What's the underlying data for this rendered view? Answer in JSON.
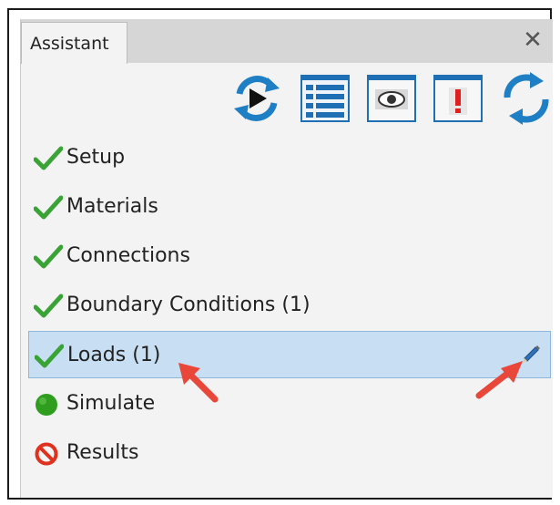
{
  "panel": {
    "tab_label": "Assistant",
    "close_symbol": "✕"
  },
  "toolbar": {
    "buttons": [
      {
        "icon": "play-refresh-icon"
      },
      {
        "icon": "list-view-icon"
      },
      {
        "icon": "eye-icon"
      },
      {
        "icon": "warning-icon"
      },
      {
        "icon": "sync-icon"
      }
    ]
  },
  "steps": [
    {
      "label": "Setup",
      "status": "complete"
    },
    {
      "label": "Materials",
      "status": "complete"
    },
    {
      "label": "Connections",
      "status": "complete"
    },
    {
      "label": "Boundary Conditions (1)",
      "status": "complete"
    },
    {
      "label": "Loads (1)",
      "status": "complete",
      "selected": true
    },
    {
      "label": "Simulate",
      "status": "ready"
    },
    {
      "label": "Results",
      "status": "blocked"
    }
  ],
  "colors": {
    "check": "#3aa335",
    "ready": "#2f9e1f",
    "blocked": "#e0301e",
    "selected_bg": "#c8dff3",
    "annotation_arrow": "#e8473a"
  }
}
